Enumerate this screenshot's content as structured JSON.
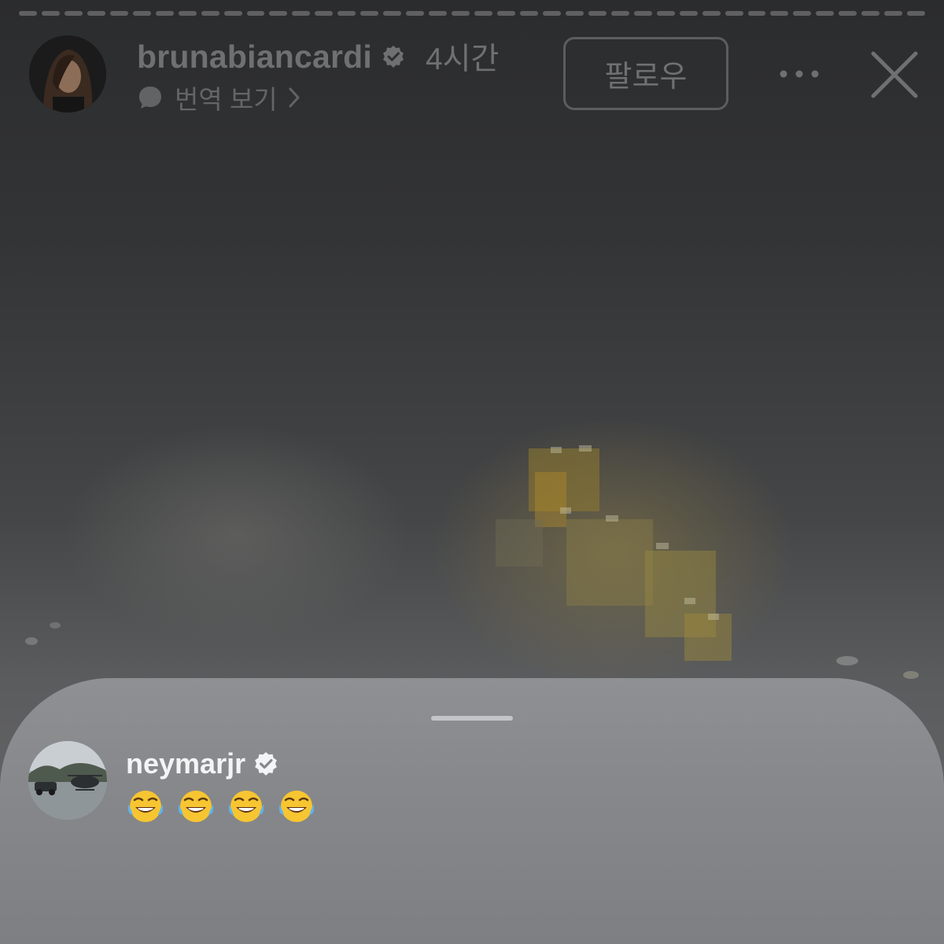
{
  "story": {
    "username": "brunabiancardi",
    "time": "4시간",
    "translate_label": "번역 보기",
    "follow_label": "팔로우",
    "progress_segments": 40
  },
  "comment_sheet": {
    "username": "neymarjr",
    "text": "😂😂😂😂"
  },
  "colors": {
    "verified": "#6f7072",
    "sheet_bg": "#85878a",
    "sheet_verified": "#f3f4f5"
  },
  "icons": {
    "verified": "verified-badge-icon",
    "translate": "speech-bubble-icon",
    "chevron": "chevron-right-icon",
    "more": "more-dots-icon",
    "close": "close-icon",
    "laugh": "tears-of-joy-emoji-icon"
  }
}
